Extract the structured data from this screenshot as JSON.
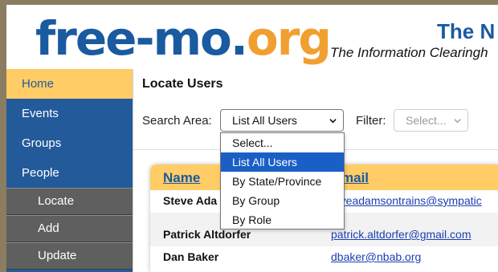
{
  "header": {
    "logo_part1": "free-mo.",
    "logo_part2": "org",
    "title": "The N",
    "subtitle": "The Information Clearingh"
  },
  "sidebar": {
    "items": [
      {
        "label": "Home",
        "active": true
      },
      {
        "label": "Events"
      },
      {
        "label": "Groups"
      },
      {
        "label": "People"
      }
    ],
    "subitems": [
      {
        "label": "Locate"
      },
      {
        "label": "Add"
      },
      {
        "label": "Update"
      }
    ]
  },
  "main": {
    "title": "Locate Users",
    "search_area_label": "Search Area:",
    "search_area_value": "List All Users",
    "filter_label": "Filter:",
    "filter_placeholder": "Select..."
  },
  "dropdown": {
    "options": [
      {
        "label": "Select..."
      },
      {
        "label": "List All Users",
        "selected": true
      },
      {
        "label": "By State/Province"
      },
      {
        "label": "By Group"
      },
      {
        "label": "By Role"
      }
    ]
  },
  "table": {
    "headers": {
      "name": "Name",
      "email": "mail"
    },
    "rows": [
      {
        "name": "Steve Ada",
        "email": "teveadamsontrains@sympatic"
      },
      {
        "name": "",
        "email": ""
      },
      {
        "name": "Patrick Altdorfer",
        "email": "patrick.altdorfer@gmail.com"
      },
      {
        "name": "Dan Baker",
        "email": "dbaker@nbab.org"
      }
    ]
  },
  "colors": {
    "brand_blue": "#1a5aa0",
    "brand_orange": "#f0a030",
    "highlight": "#ffcc66",
    "sidebar": "#235a9a",
    "sub_nav": "#5f5f5f",
    "selection": "#1a5fc6"
  },
  "icons": {
    "select_arrow": "chevron-down-icon"
  }
}
